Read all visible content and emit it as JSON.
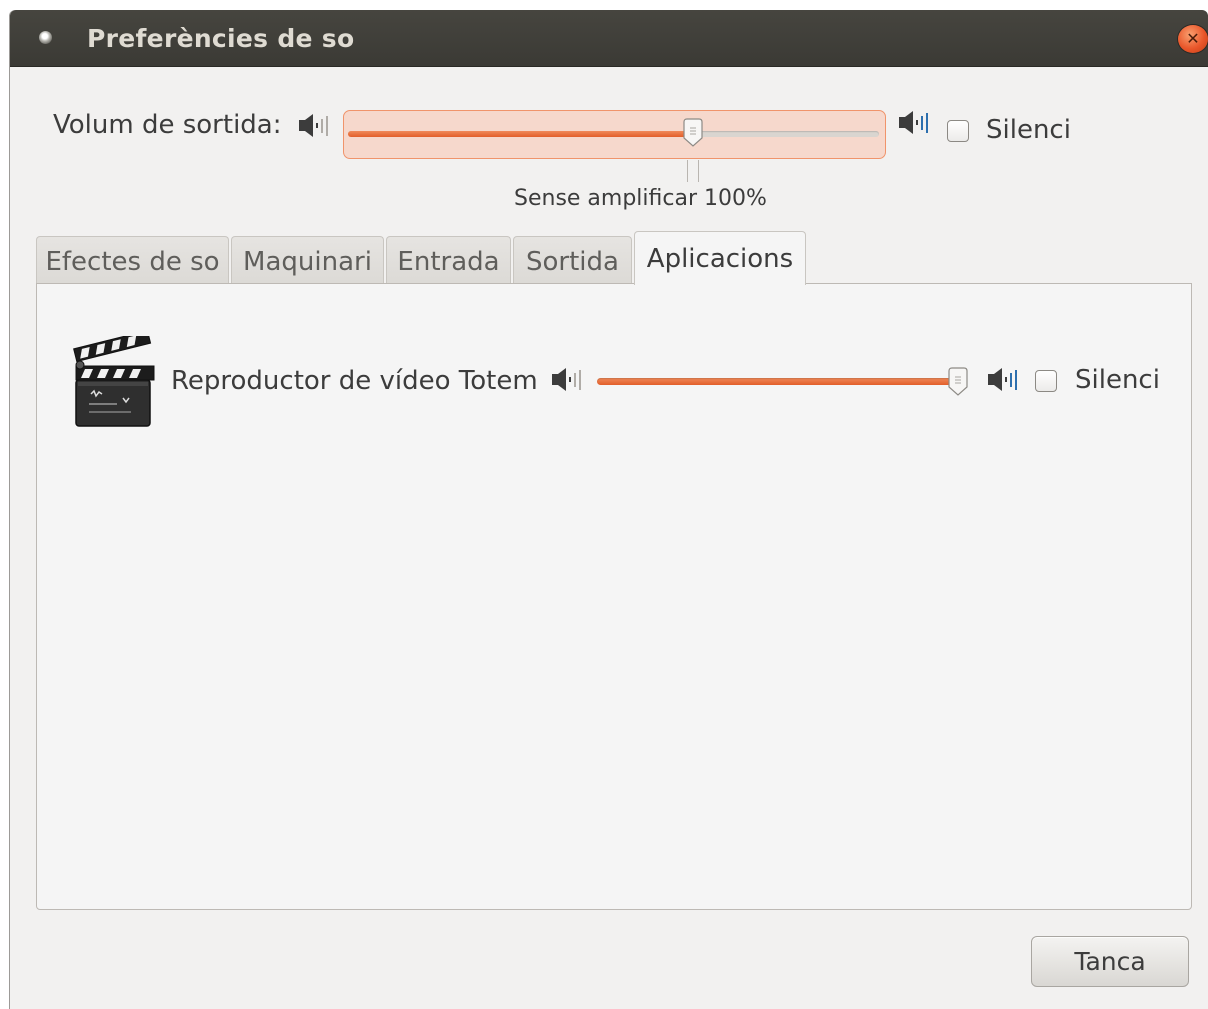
{
  "window": {
    "title": "Preferències de so"
  },
  "output": {
    "label": "Volum de sortida:",
    "volume_fraction": 0.65,
    "mark_label": "Sense amplificar 100%",
    "mute_label": "Silenci",
    "mute_checked": false
  },
  "tabs": [
    {
      "label": "Efectes de so",
      "active": false
    },
    {
      "label": "Maquinari",
      "active": false
    },
    {
      "label": "Entrada",
      "active": false
    },
    {
      "label": "Sortida",
      "active": false
    },
    {
      "label": "Aplicacions",
      "active": true
    }
  ],
  "applications": [
    {
      "name": "Reproductor de vídeo Totem",
      "icon": "clapperboard-icon",
      "volume_fraction": 1.0,
      "mute_label": "Silenci",
      "mute_checked": false
    }
  ],
  "buttons": {
    "close_label": "Tanca"
  },
  "colors": {
    "accent": "#e95420",
    "titlebar": "#3c3b37",
    "background": "#f2f1f0"
  }
}
